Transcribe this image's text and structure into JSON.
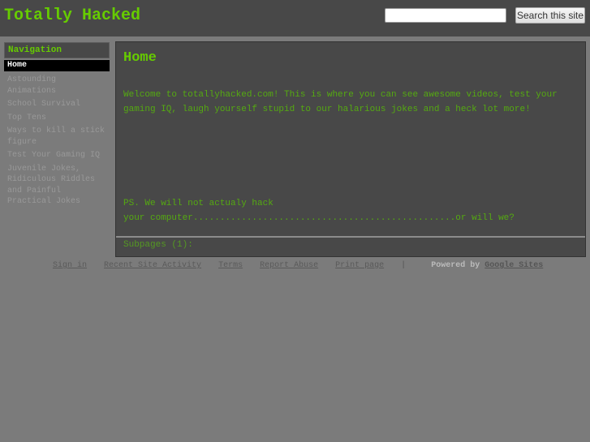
{
  "header": {
    "site_title": "Totally Hacked",
    "search_placeholder": "",
    "search_value": "",
    "search_button_label": "Search this site"
  },
  "sidebar": {
    "title": "Navigation",
    "items": [
      {
        "label": "Home",
        "active": true
      },
      {
        "label": "Astounding Animations",
        "active": false
      },
      {
        "label": "School Survival",
        "active": false
      },
      {
        "label": "Top Tens",
        "active": false
      },
      {
        "label": "Ways to kill a stick figure",
        "active": false
      },
      {
        "label": "Test Your Gaming IQ",
        "active": false
      },
      {
        "label": "Juvenile Jokes, Ridiculous Riddles and Painful Practical Jokes",
        "active": false
      }
    ]
  },
  "main": {
    "page_title": "Home",
    "welcome_text": "Welcome to totallyhacked.com! This is where you can see awesome videos, test your gaming IQ, laugh yourself stupid to our halarious jokes and a heck lot more!",
    "ps_line1": "PS. We will not actualy hack",
    "ps_line2": "your computer.................................................or will we?",
    "subpages_label": "Subpages (1):"
  },
  "footer": {
    "links": [
      "Sign in",
      "Recent Site Activity",
      "Terms",
      "Report Abuse",
      "Print page"
    ],
    "separator": "|",
    "powered_by": "Powered by",
    "google_sites": "Google Sites"
  },
  "colors": {
    "accent_green": "#66cc00",
    "header_bg": "#484848",
    "page_bg": "#7b7b7b"
  }
}
